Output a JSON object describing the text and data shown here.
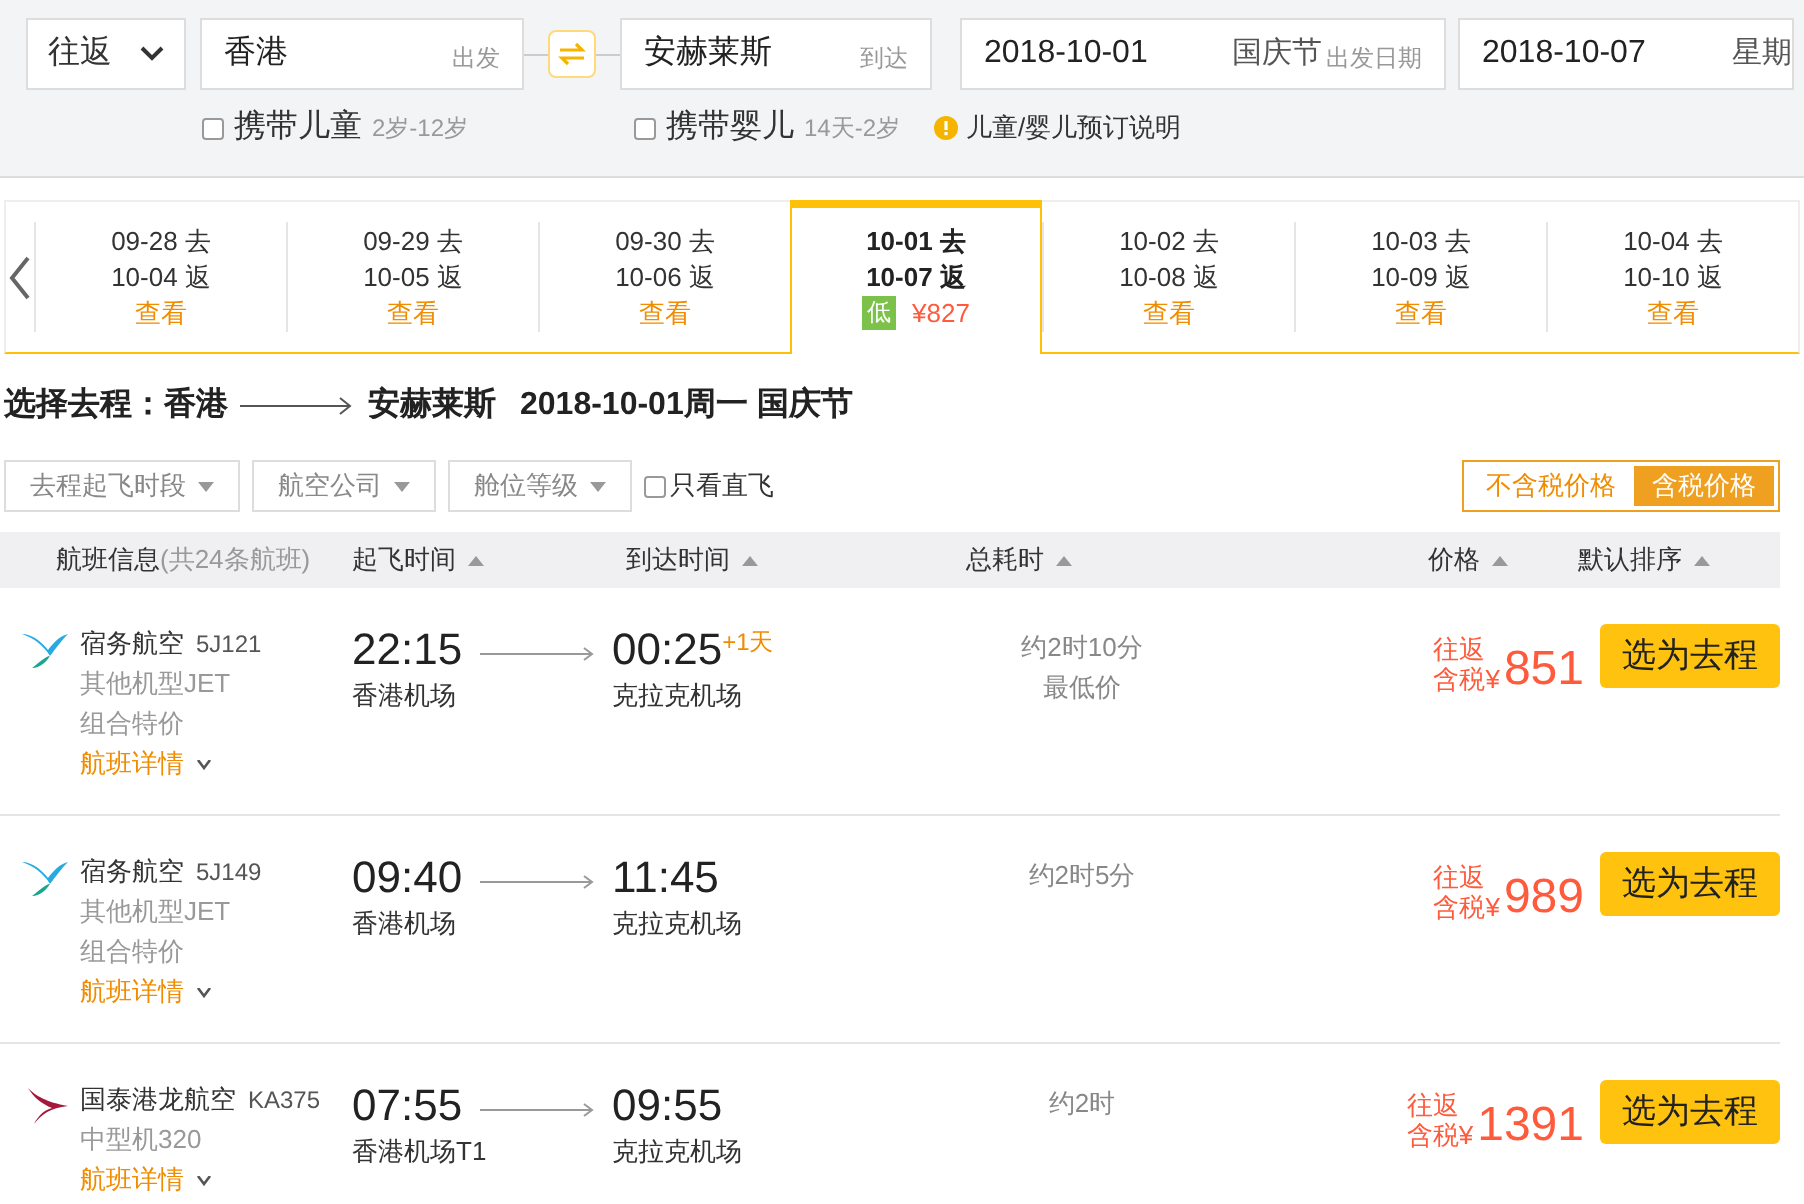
{
  "search": {
    "trip_type": "往返",
    "from": {
      "value": "香港",
      "hint": "出发"
    },
    "to": {
      "value": "安赫莱斯",
      "hint": "到达"
    },
    "depart": {
      "value": "2018-10-01",
      "holiday": "国庆节",
      "hint": "出发日期"
    },
    "return": {
      "value": "2018-10-07",
      "hint": "星期"
    },
    "options": [
      {
        "label": "携带儿童",
        "note": "2岁-12岁",
        "checked": false
      },
      {
        "label": "携带婴儿",
        "note": "14天-2岁",
        "checked": false
      }
    ],
    "info_link": "儿童/婴儿预订说明"
  },
  "date_strip": [
    {
      "go": "09-28 去",
      "back": "10-04 返",
      "price": "查看",
      "lowest": false,
      "selected": false
    },
    {
      "go": "09-29 去",
      "back": "10-05 返",
      "price": "查看",
      "lowest": false,
      "selected": false
    },
    {
      "go": "09-30 去",
      "back": "10-06 返",
      "price": "查看",
      "lowest": false,
      "selected": false
    },
    {
      "go": "10-01 去",
      "back": "10-07 返",
      "price": "¥827",
      "lowest": true,
      "badge": "低",
      "selected": true
    },
    {
      "go": "10-02 去",
      "back": "10-08 返",
      "price": "查看",
      "lowest": false,
      "selected": false
    },
    {
      "go": "10-03 去",
      "back": "10-09 返",
      "price": "查看",
      "lowest": false,
      "selected": false
    },
    {
      "go": "10-04 去",
      "back": "10-10 返",
      "price": "查看",
      "lowest": false,
      "selected": false
    }
  ],
  "heading": {
    "prefix": "选择去程：香港",
    "to": "安赫莱斯",
    "date": "2018-10-01周一 国庆节"
  },
  "filters": [
    {
      "label": "去程起飞时段"
    },
    {
      "label": "航空公司"
    },
    {
      "label": "舱位等级"
    }
  ],
  "direct_only": {
    "label": "只看直飞",
    "checked": false
  },
  "price_mode": [
    {
      "label": "不含税价格",
      "selected": false
    },
    {
      "label": "含税价格",
      "selected": true
    }
  ],
  "table": {
    "columns": [
      {
        "label": "航班信息",
        "note": "(共24条航班)",
        "sortable": false
      },
      {
        "label": "起飞时间",
        "sortable": true
      },
      {
        "label": "到达时间",
        "sortable": true
      },
      {
        "label": "总耗时",
        "sortable": true
      },
      {
        "label": "价格",
        "sortable": true
      },
      {
        "label": "默认排序",
        "sortable": true
      }
    ],
    "rows": [
      {
        "airline": "宿务航空",
        "flight": "5J121",
        "kind": "cebu",
        "aircraft": "其他机型JET",
        "tag": "组合特价",
        "details": "航班详情",
        "dep_time": "22:15",
        "dep_airport": "香港机场",
        "arr_time": "00:25",
        "next_day": "+1天",
        "arr_airport": "克拉克机场",
        "duration": "约2时10分",
        "note": "最低价",
        "price_label_1": "往返",
        "price_label_2": "含税¥",
        "price": "851",
        "action": "选为去程"
      },
      {
        "airline": "宿务航空",
        "flight": "5J149",
        "kind": "cebu",
        "aircraft": "其他机型JET",
        "tag": "组合特价",
        "details": "航班详情",
        "dep_time": "09:40",
        "dep_airport": "香港机场",
        "arr_time": "11:45",
        "arr_airport": "克拉克机场",
        "duration": "约2时5分",
        "price_label_1": "往返",
        "price_label_2": "含税¥",
        "price": "989",
        "action": "选为去程"
      },
      {
        "airline": "国泰港龙航空",
        "flight": "KA375",
        "kind": "cathay",
        "aircraft": "中型机320",
        "details": "航班详情",
        "dep_time": "07:55",
        "dep_airport": "香港机场T1",
        "arr_time": "09:55",
        "arr_airport": "克拉克机场",
        "duration": "约2时",
        "price_label_1": "往返",
        "price_label_2": "含税¥",
        "price": "1391",
        "action": "选为去程"
      }
    ]
  }
}
